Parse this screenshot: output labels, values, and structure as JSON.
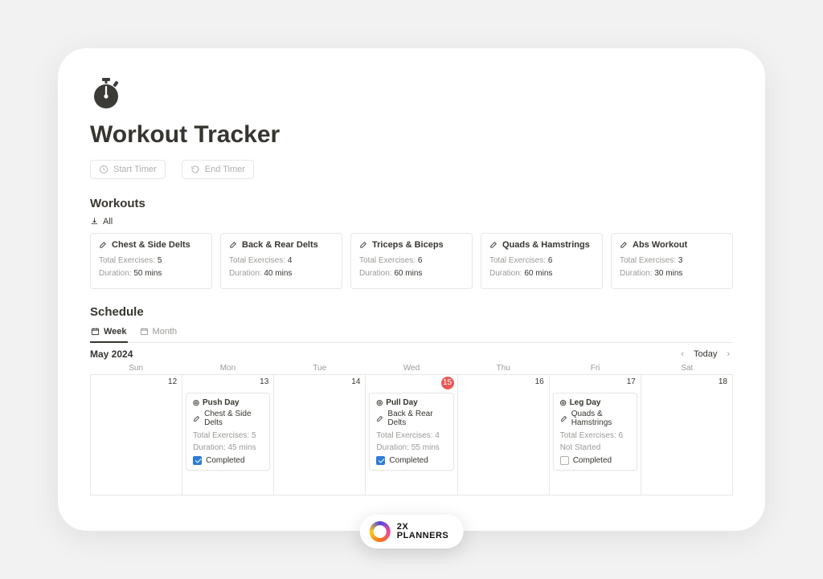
{
  "page": {
    "title": "Workout Tracker",
    "icon": "stopwatch-icon"
  },
  "timer": {
    "start_label": "Start Timer",
    "end_label": "End Timer"
  },
  "workouts": {
    "section_title": "Workouts",
    "all_label": "All",
    "exercises_label_prefix": "Total Exercises:",
    "duration_label_prefix": "Duration:",
    "cards": [
      {
        "name": "Chest & Side Delts",
        "total_exercises": "5",
        "duration": "50 mins"
      },
      {
        "name": "Back & Rear Delts",
        "total_exercises": "4",
        "duration": "40 mins"
      },
      {
        "name": "Triceps & Biceps",
        "total_exercises": "6",
        "duration": "60 mins"
      },
      {
        "name": "Quads & Hamstrings",
        "total_exercises": "6",
        "duration": "60 mins"
      },
      {
        "name": "Abs Workout",
        "total_exercises": "3",
        "duration": "30 mins"
      }
    ]
  },
  "schedule": {
    "section_title": "Schedule",
    "tabs": {
      "week": "Week",
      "month": "Month"
    },
    "month_label": "May 2024",
    "today_label": "Today",
    "days_of_week": [
      "Sun",
      "Mon",
      "Tue",
      "Wed",
      "Thu",
      "Fri",
      "Sat"
    ],
    "dates": [
      "12",
      "13",
      "14",
      "15",
      "16",
      "17",
      "18"
    ],
    "today_index": 3,
    "events": {
      "1": {
        "title": "Push Day",
        "workout": "Chest & Side Delts",
        "total_exercises": "5",
        "duration": "45 mins",
        "status_label": "Completed",
        "completed": true
      },
      "3": {
        "title": "Pull Day",
        "workout": "Back & Rear Delts",
        "total_exercises": "4",
        "duration": "55 mins",
        "status_label": "Completed",
        "completed": true
      },
      "5": {
        "title": "Leg Day",
        "workout": "Quads & Hamstrings",
        "total_exercises": "6",
        "not_started_label": "Not Started",
        "status_label": "Completed",
        "completed": false
      }
    }
  },
  "brand": {
    "line1": "2X",
    "line2": "PLANNERS"
  }
}
